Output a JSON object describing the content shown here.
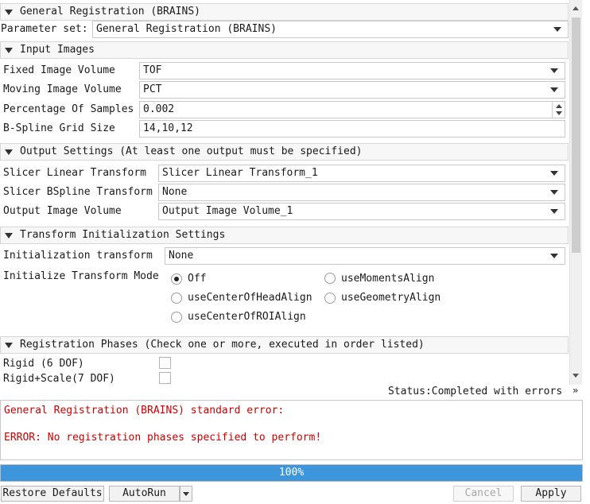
{
  "module": {
    "title": "General Registration (BRAINS)",
    "parameter_set_label": "Parameter set:",
    "parameter_set_value": "General Registration (BRAINS)"
  },
  "input_images": {
    "title": "Input Images",
    "fixed_label": "Fixed Image Volume",
    "fixed_value": "TOF",
    "moving_label": "Moving Image Volume",
    "moving_value": "PCT",
    "samples_label": "Percentage Of Samples",
    "samples_value": "0.002",
    "grid_label": "B-Spline Grid Size",
    "grid_value": "14,10,12"
  },
  "output_settings": {
    "title": "Output Settings (At least one output must be specified)",
    "linear_label": "Slicer Linear Transform",
    "linear_value": "Slicer Linear Transform_1",
    "bspline_label": "Slicer BSpline Transform",
    "bspline_value": "None",
    "volume_label": "Output Image Volume",
    "volume_value": "Output Image Volume_1"
  },
  "transform_init": {
    "title": "Transform Initialization Settings",
    "init_label": "Initialization transform",
    "init_value": "None",
    "mode_label": "Initialize Transform Mode",
    "modes": [
      "Off",
      "useMomentsAlign",
      "useCenterOfHeadAlign",
      "useGeometryAlign",
      "useCenterOfROIAlign"
    ],
    "selected_mode": "Off"
  },
  "registration_phases": {
    "title": "Registration Phases (Check one or more, executed in order listed)",
    "phases": [
      {
        "label": "Rigid (6 DOF)",
        "checked": false
      },
      {
        "label": "Rigid+Scale(7 DOF)",
        "checked": false
      }
    ]
  },
  "status": {
    "text": "Status:Completed with errors",
    "error_line1": "General Registration (BRAINS) standard error:",
    "error_line2": "ERROR: No registration phases specified to perform!",
    "error_color": "#cc0000"
  },
  "progress": {
    "value": 1.0,
    "text": "100%",
    "fill_color": "#3d95db"
  },
  "buttons": {
    "restore": "Restore Defaults",
    "autorun": "AutoRun",
    "cancel": "Cancel",
    "apply": "Apply"
  }
}
